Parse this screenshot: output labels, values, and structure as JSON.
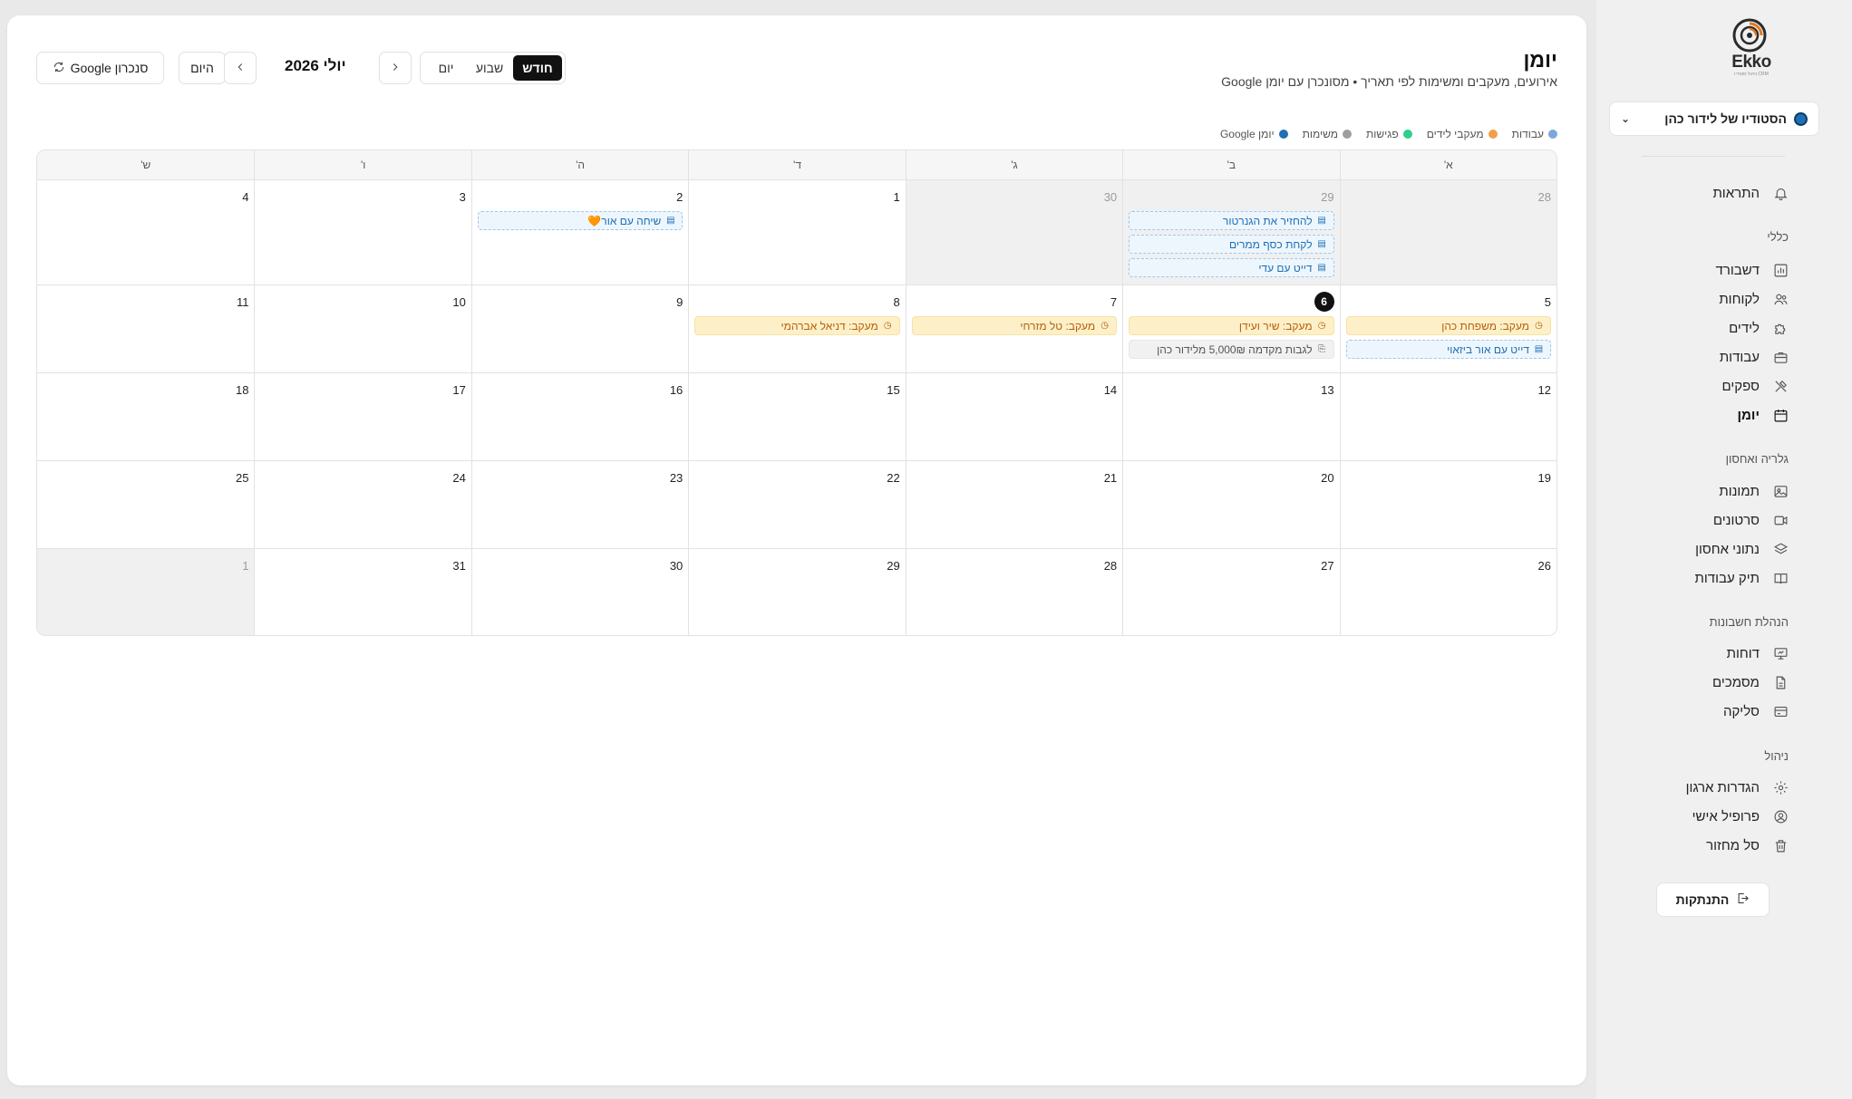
{
  "sidebar": {
    "brand": "Ekko",
    "brand_tagline": "ניהול סטודיו CRM",
    "workspace": "הסטודיו של לידור כהן",
    "nav_top": {
      "notifications": "התראות"
    },
    "sections": {
      "general": "כללי",
      "gallery": "גלריה ואחסון",
      "accounting": "הנהלת חשבונות",
      "management": "ניהול"
    },
    "general_items": [
      "דשבורד",
      "לקוחות",
      "לידים",
      "עבודות",
      "ספקים",
      "יומן"
    ],
    "gallery_items": [
      "תמונות",
      "סרטונים",
      "נתוני אחסון",
      "תיק עבודות"
    ],
    "accounting_items": [
      "דוחות",
      "מסמכים",
      "סליקה"
    ],
    "management_items": [
      "הגדרות ארגון",
      "פרופיל אישי",
      "סל מחזור"
    ],
    "logout": "התנתקות"
  },
  "header": {
    "title": "יומן",
    "subtitle": "אירועים, מעקבים ומשימות לפי תאריך • מסונכרן עם יומן Google",
    "sync_button": "סנכרון Google",
    "today_button": "היום",
    "month_label": "יולי 2026",
    "views": {
      "month": "חודש",
      "week": "שבוע",
      "day": "יום"
    },
    "active_view": "חודש"
  },
  "legend": [
    {
      "label": "עבודות",
      "color": "#7da7d9"
    },
    {
      "label": "מעקבי לידים",
      "color": "#f0a04b"
    },
    {
      "label": "פגישות",
      "color": "#2ecf8a"
    },
    {
      "label": "משימות",
      "color": "#9e9e9e"
    },
    {
      "label": "יומן Google",
      "color": "#1f6fb4"
    }
  ],
  "calendar": {
    "weekdays": [
      "א'",
      "ב'",
      "ג'",
      "ד'",
      "ה'",
      "ו'",
      "ש'"
    ],
    "weeks": [
      [
        {
          "day": "28",
          "outside": true,
          "events": []
        },
        {
          "day": "29",
          "outside": true,
          "events": [
            {
              "type": "gcal",
              "text": "להחזיר את הגנרטור"
            },
            {
              "type": "gcal",
              "text": "לקחת כסף ממרים"
            },
            {
              "type": "gcal",
              "text": "דייט עם עדי"
            }
          ]
        },
        {
          "day": "30",
          "outside": true,
          "events": []
        },
        {
          "day": "1",
          "events": []
        },
        {
          "day": "2",
          "events": [
            {
              "type": "gcal",
              "text": "שיחה עם אור🧡"
            }
          ]
        },
        {
          "day": "3",
          "events": []
        },
        {
          "day": "4",
          "events": []
        }
      ],
      [
        {
          "day": "5",
          "events": [
            {
              "type": "follow",
              "text": "מעקב: משפחת כהן"
            },
            {
              "type": "gcal",
              "text": "דייט עם אור ביזאוי"
            }
          ]
        },
        {
          "day": "6",
          "today": true,
          "events": [
            {
              "type": "follow",
              "text": "מעקב: שיר ועידן"
            },
            {
              "type": "task",
              "text": "לגבות מקדמה 5,000₪ מלידור כהן"
            }
          ]
        },
        {
          "day": "7",
          "events": [
            {
              "type": "follow",
              "text": "מעקב: טל מזרחי"
            }
          ]
        },
        {
          "day": "8",
          "events": [
            {
              "type": "follow",
              "text": "מעקב: דניאל אברהמי"
            }
          ]
        },
        {
          "day": "9",
          "events": []
        },
        {
          "day": "10",
          "events": []
        },
        {
          "day": "11",
          "events": []
        }
      ],
      [
        {
          "day": "12",
          "events": []
        },
        {
          "day": "13",
          "events": []
        },
        {
          "day": "14",
          "events": []
        },
        {
          "day": "15",
          "events": []
        },
        {
          "day": "16",
          "events": []
        },
        {
          "day": "17",
          "events": []
        },
        {
          "day": "18",
          "events": []
        }
      ],
      [
        {
          "day": "19",
          "events": []
        },
        {
          "day": "20",
          "events": []
        },
        {
          "day": "21",
          "events": []
        },
        {
          "day": "22",
          "events": []
        },
        {
          "day": "23",
          "events": []
        },
        {
          "day": "24",
          "events": []
        },
        {
          "day": "25",
          "events": []
        }
      ],
      [
        {
          "day": "26",
          "events": []
        },
        {
          "day": "27",
          "events": []
        },
        {
          "day": "28",
          "events": []
        },
        {
          "day": "29",
          "events": []
        },
        {
          "day": "30",
          "events": []
        },
        {
          "day": "31",
          "events": []
        },
        {
          "day": "1",
          "outside": true,
          "events": []
        }
      ]
    ]
  },
  "icons": {
    "notifications": "bell-icon",
    "dashboard": "chart-icon",
    "customers": "users-icon",
    "leads": "puzzle-icon",
    "jobs": "briefcase-icon",
    "suppliers": "tools-icon",
    "calendar": "calendar-icon",
    "photos": "image-icon",
    "videos": "video-icon",
    "storage": "layers-icon",
    "portfolio": "book-icon",
    "reports": "presentation-icon",
    "documents": "document-icon",
    "billing": "credit-card-icon",
    "org_settings": "gear-icon",
    "profile": "user-circle-icon",
    "trash": "trash-icon"
  }
}
